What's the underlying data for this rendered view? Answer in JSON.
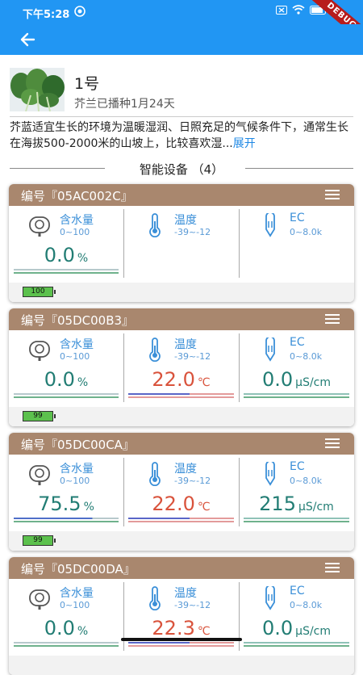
{
  "status_bar": {
    "time": "下午5:28",
    "debug_banner": "DEBUG"
  },
  "profile": {
    "name": "1号",
    "subtitle": "芥兰已播种1月24天"
  },
  "description": {
    "text": "芥蓝适宜生长的环境为温暖湿润、日照充足的气候条件下，通常生长在海拔500-2000米的山坡上，比较喜欢湿...",
    "more": "展开"
  },
  "section": {
    "title": "智能设备 （4）"
  },
  "devices": [
    {
      "code": "编号『05AC002C』",
      "battery": "100",
      "moisture": {
        "label": "含水量",
        "range": "0~100",
        "value": "0.0",
        "unit": "%"
      },
      "temperature": {
        "label": "温度",
        "range": "-39~-12",
        "value": "",
        "unit": ""
      },
      "ec": {
        "label": "EC",
        "range": "0~8.0k",
        "value": "",
        "unit": ""
      }
    },
    {
      "code": "编号『05DC00B3』",
      "battery": "99",
      "moisture": {
        "label": "含水量",
        "range": "0~100",
        "value": "0.0",
        "unit": "%"
      },
      "temperature": {
        "label": "温度",
        "range": "-39~-12",
        "value": "22.0",
        "unit": "℃"
      },
      "ec": {
        "label": "EC",
        "range": "0~8.0k",
        "value": "0.0",
        "unit": "μS/cm"
      }
    },
    {
      "code": "编号『05DC00CA』",
      "battery": "99",
      "moisture": {
        "label": "含水量",
        "range": "0~100",
        "value": "75.5",
        "unit": "%"
      },
      "temperature": {
        "label": "温度",
        "range": "-39~-12",
        "value": "22.0",
        "unit": "℃"
      },
      "ec": {
        "label": "EC",
        "range": "0~8.0k",
        "value": "215",
        "unit": "μS/cm"
      }
    },
    {
      "code": "编号『05DC00DA』",
      "battery": "",
      "moisture": {
        "label": "含水量",
        "range": "0~100",
        "value": "0.0",
        "unit": "%"
      },
      "temperature": {
        "label": "温度",
        "range": "-39~-12",
        "value": "22.3",
        "unit": "℃"
      },
      "ec": {
        "label": "EC",
        "range": "0~8.0k",
        "value": "0.0",
        "unit": "μS/cm"
      }
    }
  ],
  "colors": {
    "primary": "#2196f3",
    "card_header": "#a9876e",
    "label": "#3a8fd8",
    "value_teal": "#227d74",
    "value_red": "#d9533c",
    "battery": "#5cc14d"
  }
}
